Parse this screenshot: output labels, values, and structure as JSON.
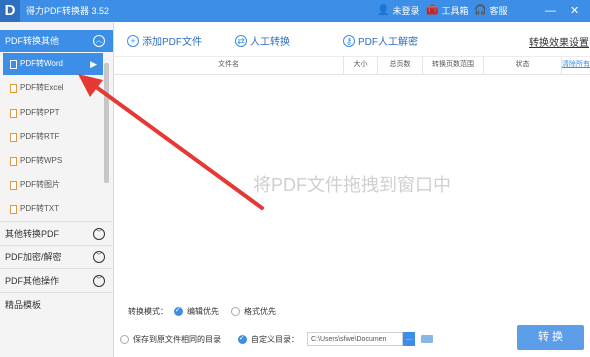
{
  "app": {
    "logo_letter": "D",
    "title": "得力PDF转换器 3.52"
  },
  "titlebar": {
    "login": "未登录",
    "toolbox": "工具箱",
    "service": "客服",
    "min": "—",
    "close": "✕"
  },
  "sidebar": {
    "group1": {
      "label": "PDF转换其他",
      "expanded": true
    },
    "items": [
      {
        "label": "PDF转Word",
        "selected": true
      },
      {
        "label": "PDF转Excel"
      },
      {
        "label": "PDF转PPT"
      },
      {
        "label": "PDF转RTF"
      },
      {
        "label": "PDF转WPS"
      },
      {
        "label": "PDF转图片"
      },
      {
        "label": "PDF转TXT"
      }
    ],
    "group2": {
      "label": "其他转换PDF"
    },
    "group3": {
      "label": "PDF加密/解密"
    },
    "group4": {
      "label": "PDF其他操作"
    },
    "group5": {
      "label": "精品模板"
    }
  },
  "toolbar": {
    "add": "添加PDF文件",
    "manual": "人工转换",
    "unlock": "PDF人工解密",
    "effect": "转换效果设置"
  },
  "table": {
    "headers": [
      "文件名",
      "大小",
      "总页数",
      "转换页数范围",
      "状态",
      "清除所有"
    ]
  },
  "dropzone": {
    "hint": "将PDF文件拖拽到窗口中"
  },
  "options": {
    "mode_label": "转换模式：",
    "mode_edit": "编辑优先",
    "mode_format": "格式优先",
    "save_same": "保存到原文件相同的目录",
    "custom_dir": "自定义目录：",
    "path_value": "C:\\Users\\sfwe\\Documen",
    "browse": "..."
  },
  "convert_button": "转 换",
  "colors": {
    "accent": "#3c8ee6",
    "arrow": "#e53935"
  }
}
